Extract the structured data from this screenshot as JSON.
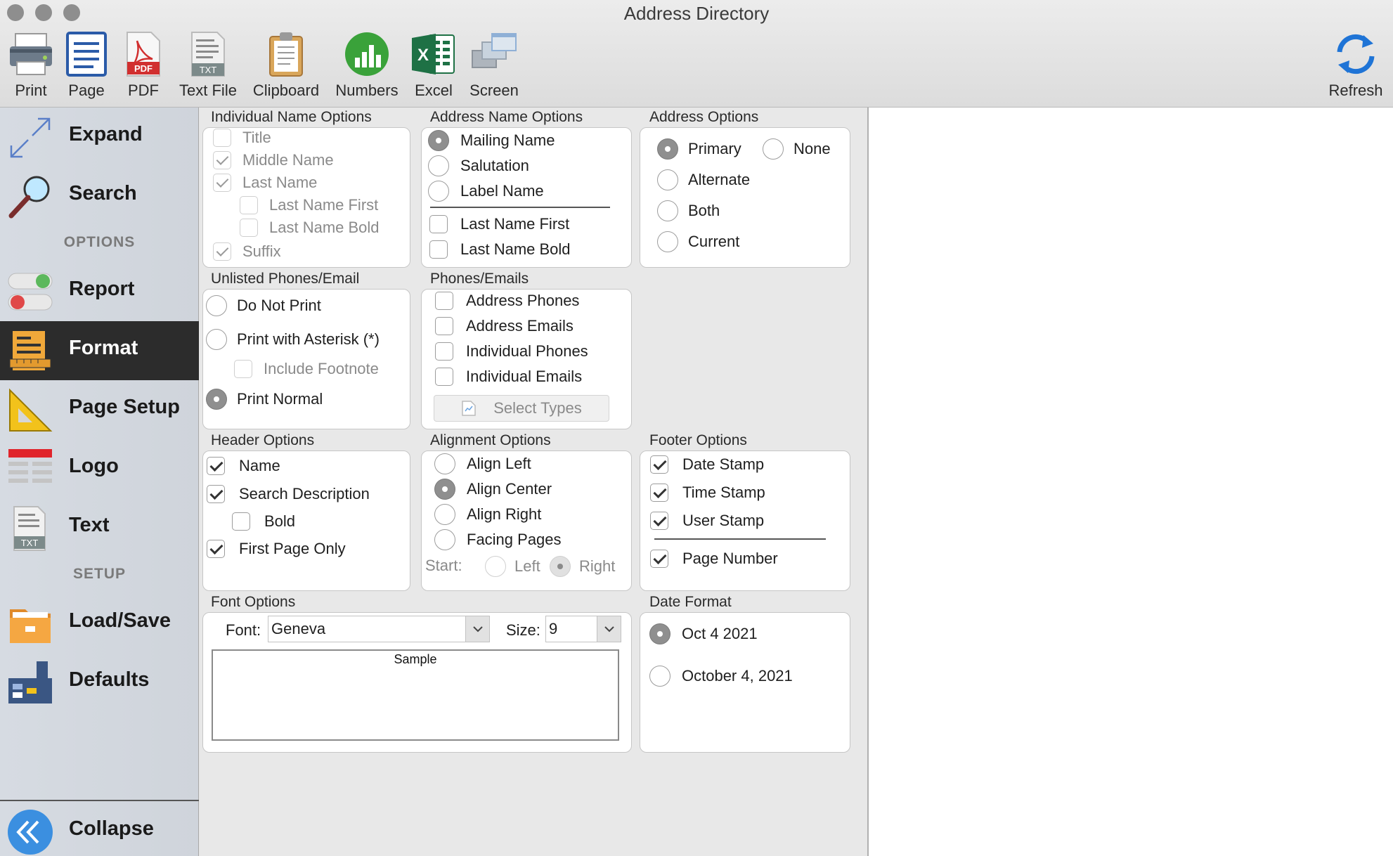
{
  "window": {
    "title": "Address Directory"
  },
  "toolbar": {
    "items": [
      {
        "id": "print",
        "label": "Print",
        "icon": "printer-icon"
      },
      {
        "id": "page",
        "label": "Page",
        "icon": "page-icon"
      },
      {
        "id": "pdf",
        "label": "PDF",
        "icon": "pdf-icon",
        "badge": "PDF"
      },
      {
        "id": "text-file",
        "label": "Text File",
        "icon": "text-file-icon",
        "badge": "TXT"
      },
      {
        "id": "clipboard",
        "label": "Clipboard",
        "icon": "clipboard-icon"
      },
      {
        "id": "numbers",
        "label": "Numbers",
        "icon": "numbers-icon"
      },
      {
        "id": "excel",
        "label": "Excel",
        "icon": "excel-icon"
      },
      {
        "id": "screen",
        "label": "Screen",
        "icon": "screen-icon"
      }
    ],
    "refresh_label": "Refresh"
  },
  "sidebar": {
    "expand": "Expand",
    "search": "Search",
    "options_heading": "OPTIONS",
    "report": "Report",
    "format": "Format",
    "page_setup": "Page Setup",
    "logo": "Logo",
    "text": "Text",
    "text_badge": "TXT",
    "setup_heading": "SETUP",
    "load_save": "Load/Save",
    "defaults": "Defaults",
    "collapse": "Collapse",
    "active": "Format"
  },
  "individual_name_options": {
    "title": "Individual Name Options",
    "items": [
      {
        "label": "Title",
        "checked": false
      },
      {
        "label": "Middle Name",
        "checked": true
      },
      {
        "label": "Last Name",
        "checked": true
      },
      {
        "label": "Last Name First",
        "checked": false
      },
      {
        "label": "Last Name Bold",
        "checked": false
      },
      {
        "label": "Suffix",
        "checked": true
      }
    ]
  },
  "address_name_options": {
    "title": "Address Name Options",
    "radios": [
      {
        "label": "Mailing Name",
        "selected": true
      },
      {
        "label": "Salutation",
        "selected": false
      },
      {
        "label": "Label Name",
        "selected": false
      }
    ],
    "checks": [
      {
        "label": "Last Name First",
        "checked": false
      },
      {
        "label": "Last Name Bold",
        "checked": false
      }
    ]
  },
  "address_options": {
    "title": "Address Options",
    "items": [
      {
        "label": "Primary",
        "selected": true
      },
      {
        "label": "None",
        "selected": false
      },
      {
        "label": "Alternate",
        "selected": false
      },
      {
        "label": "Both",
        "selected": false
      },
      {
        "label": "Current",
        "selected": false
      }
    ]
  },
  "unlisted_phones": {
    "title": "Unlisted Phones/Email",
    "do_not_print": "Do Not Print",
    "print_with_asterisk": "Print with Asterisk (*)",
    "include_footnote": "Include Footnote",
    "print_normal": "Print Normal",
    "selected": "Print Normal"
  },
  "phones_emails": {
    "title": "Phones/Emails",
    "items": [
      {
        "label": "Address Phones",
        "checked": false
      },
      {
        "label": "Address Emails",
        "checked": false
      },
      {
        "label": "Individual Phones",
        "checked": false
      },
      {
        "label": "Individual Emails",
        "checked": false
      }
    ],
    "select_types": "Select Types"
  },
  "header_options": {
    "title": "Header Options",
    "items": [
      {
        "label": "Name",
        "checked": true
      },
      {
        "label": "Search Description",
        "checked": true
      },
      {
        "label": "Bold",
        "checked": false
      },
      {
        "label": "First Page Only",
        "checked": true
      }
    ]
  },
  "alignment_options": {
    "title": "Alignment Options",
    "items": [
      {
        "label": "Align Left",
        "selected": false
      },
      {
        "label": "Align Center",
        "selected": true
      },
      {
        "label": "Align Right",
        "selected": false
      },
      {
        "label": "Facing Pages",
        "selected": false
      }
    ],
    "start_label": "Start:",
    "start_left": "Left",
    "start_right": "Right",
    "start_selected": "Right"
  },
  "footer_options": {
    "title": "Footer Options",
    "items": [
      {
        "label": "Date Stamp",
        "checked": true
      },
      {
        "label": "Time Stamp",
        "checked": true
      },
      {
        "label": "User Stamp",
        "checked": true
      },
      {
        "label": "Page Number",
        "checked": true
      }
    ]
  },
  "font_options": {
    "title": "Font Options",
    "font_label": "Font:",
    "font_value": "Geneva",
    "size_label": "Size:",
    "size_value": "9",
    "sample_text": "Sample"
  },
  "date_format": {
    "title": "Date Format",
    "items": [
      {
        "label": "Oct 4 2021",
        "selected": true
      },
      {
        "label": "October 4, 2021",
        "selected": false
      }
    ]
  },
  "colors": {
    "sidebar_active_bg": "#2c2c2c",
    "numbers_green": "#3aa23a",
    "excel_green": "#1e7145",
    "pdf_red": "#d12f2f",
    "refresh_blue": "#1f74d6",
    "collapse_blue": "#3b8fe0"
  }
}
